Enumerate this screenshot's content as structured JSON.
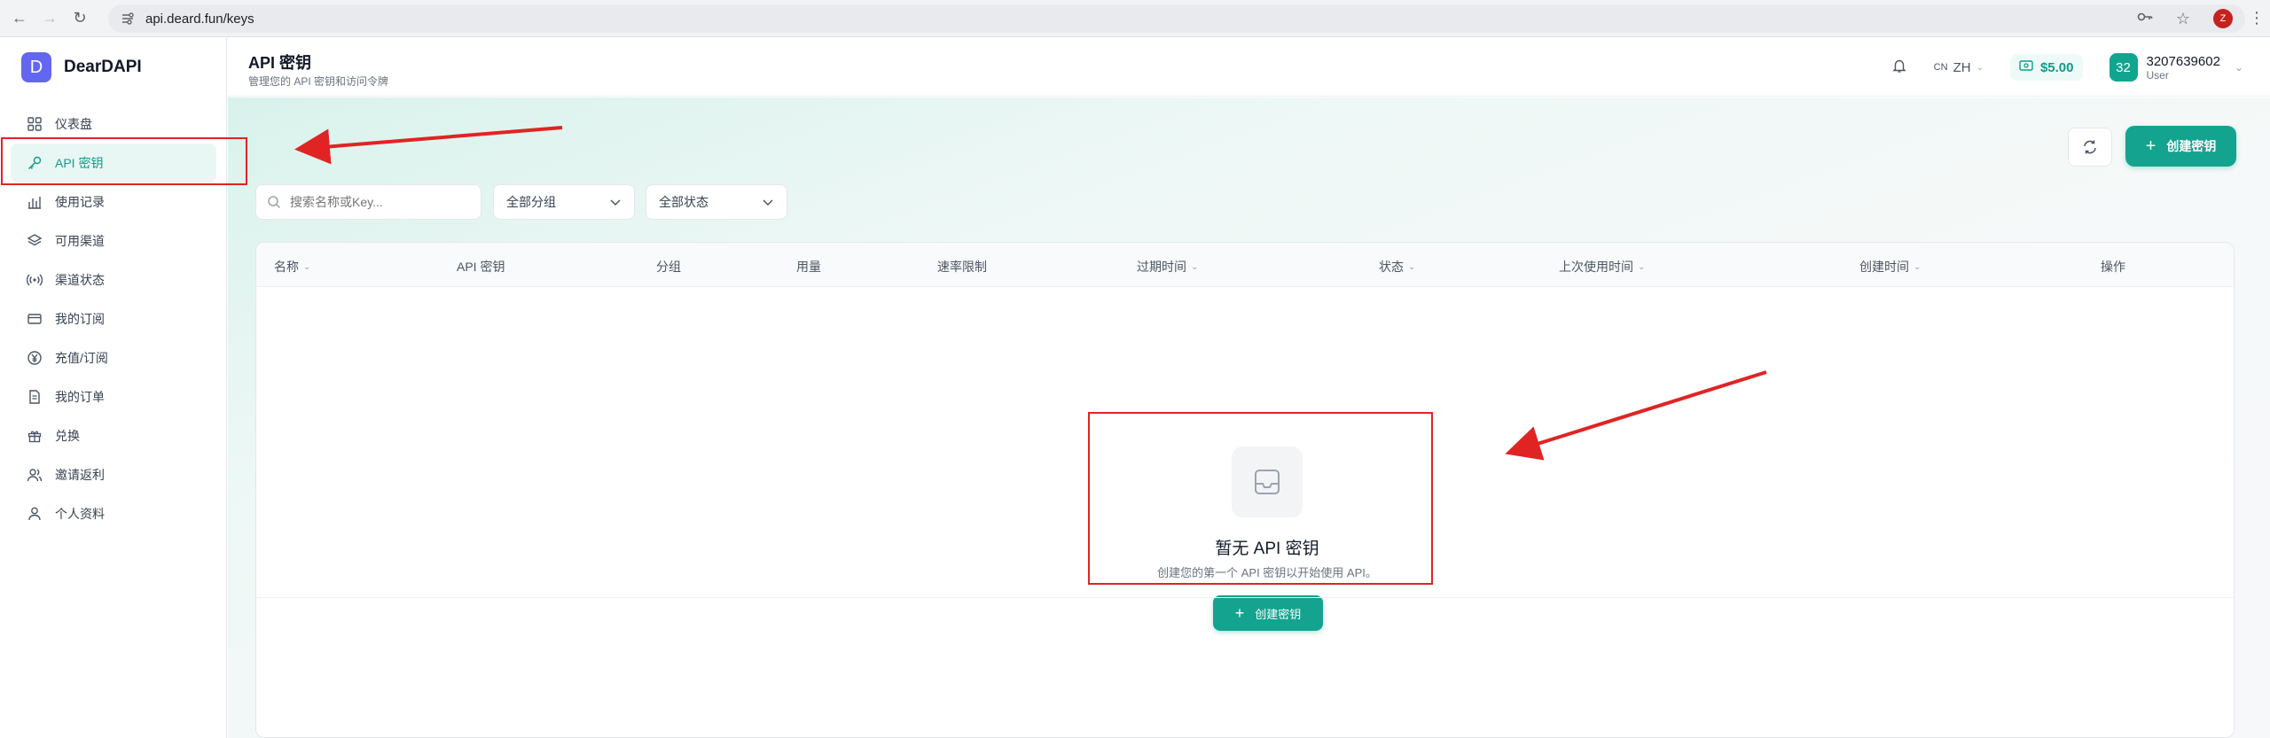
{
  "browser": {
    "url": "api.deard.fun/keys",
    "profile_initial": "Z"
  },
  "brand": {
    "logo_letter": "D",
    "name": "DearDAPI",
    "accent": "#14a38f",
    "logo_color": "#6366f1"
  },
  "sidebar": {
    "items": [
      {
        "label": "仪表盘",
        "icon": "dashboard-icon"
      },
      {
        "label": "API 密钥",
        "icon": "key-icon",
        "active": true
      },
      {
        "label": "使用记录",
        "icon": "bar-chart-icon"
      },
      {
        "label": "可用渠道",
        "icon": "layers-icon"
      },
      {
        "label": "渠道状态",
        "icon": "signal-icon"
      },
      {
        "label": "我的订阅",
        "icon": "card-icon"
      },
      {
        "label": "充值/订阅",
        "icon": "yen-icon"
      },
      {
        "label": "我的订单",
        "icon": "document-icon"
      },
      {
        "label": "兑换",
        "icon": "gift-icon"
      },
      {
        "label": "邀请返利",
        "icon": "users-icon"
      },
      {
        "label": "个人资料",
        "icon": "person-icon"
      }
    ]
  },
  "header": {
    "title": "API 密钥",
    "subtitle": "管理您的 API 密钥和访问令牌",
    "lang_code": "CN",
    "lang": "ZH",
    "balance": "$5.00",
    "user_avatar": "32",
    "user_id": "3207639602",
    "user_role": "User"
  },
  "toolbar": {
    "create_label": "创建密钥"
  },
  "filters": {
    "search_placeholder": "搜索名称或Key...",
    "group_select": "全部分组",
    "status_select": "全部状态"
  },
  "table": {
    "columns": [
      {
        "label": "名称",
        "sortable": true
      },
      {
        "label": "API 密钥",
        "sortable": false
      },
      {
        "label": "分组",
        "sortable": false
      },
      {
        "label": "用量",
        "sortable": false
      },
      {
        "label": "速率限制",
        "sortable": false
      },
      {
        "label": "过期时间",
        "sortable": true
      },
      {
        "label": "状态",
        "sortable": true
      },
      {
        "label": "上次使用时间",
        "sortable": true
      },
      {
        "label": "创建时间",
        "sortable": true
      },
      {
        "label": "操作",
        "sortable": false
      }
    ]
  },
  "empty_state": {
    "title": "暂无 API 密钥",
    "description": "创建您的第一个 API 密钥以开始使用 API。",
    "button_label": "创建密钥"
  },
  "annotation_color": "#e02424"
}
